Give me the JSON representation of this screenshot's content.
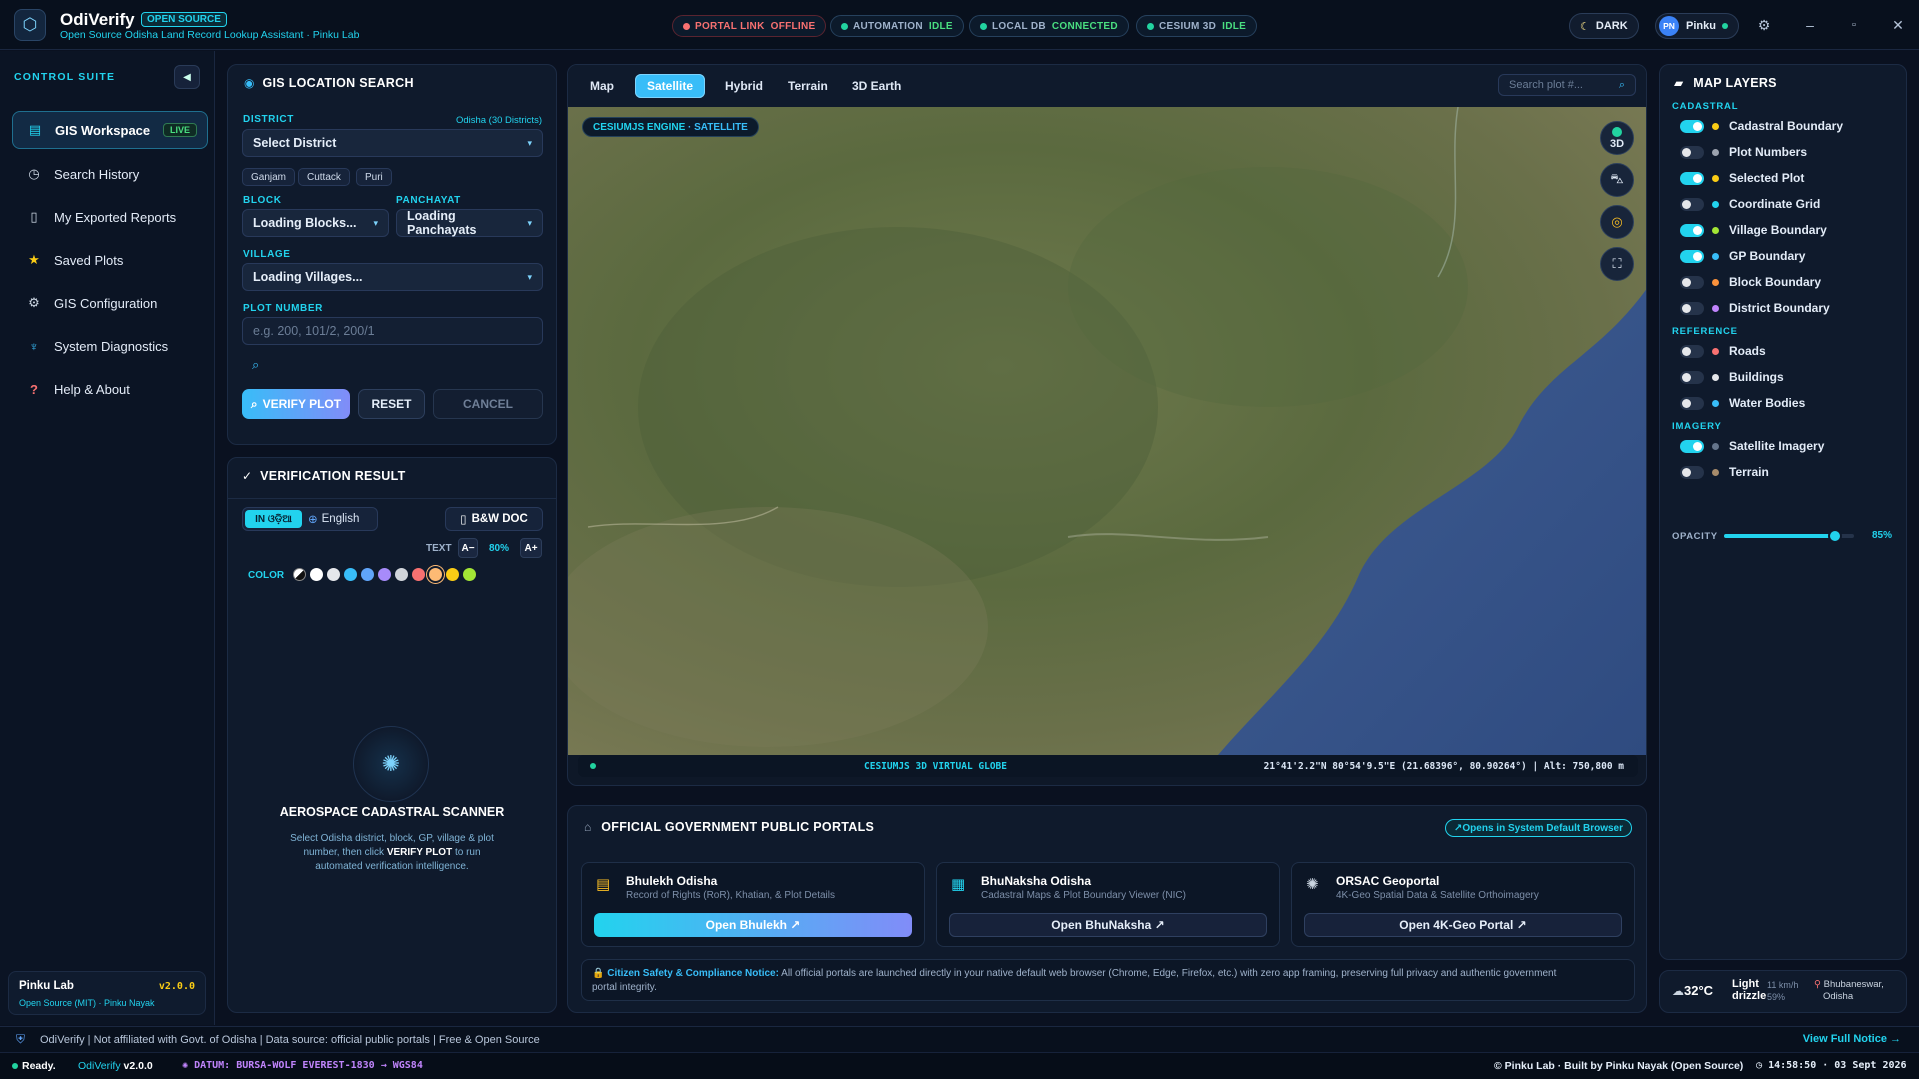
{
  "topbar": {
    "app_name": "OdiVerify",
    "badge": "OPEN SOURCE",
    "subtitle": "Open Source Odisha Land Record Lookup Assistant · Pinku Lab",
    "statuses": [
      {
        "label": "PORTAL LINK",
        "value": "OFFLINE",
        "color": "#f87171"
      },
      {
        "label": "AUTOMATION",
        "value": "IDLE",
        "color": "#22d3a0"
      },
      {
        "label": "LOCAL DB",
        "value": "CONNECTED",
        "color": "#22d3a0"
      },
      {
        "label": "CESIUM 3D",
        "value": "IDLE",
        "color": "#22d3a0"
      }
    ],
    "theme_label": "DARK",
    "user_initials": "PN",
    "user_name": "Pinku"
  },
  "sidebar": {
    "heading": "CONTROL SUITE",
    "items": [
      {
        "label": "GIS Workspace",
        "icon": "map-icon",
        "badge": "LIVE"
      },
      {
        "label": "Search History",
        "icon": "clock-icon"
      },
      {
        "label": "My Exported Reports",
        "icon": "document-icon"
      },
      {
        "label": "Saved Plots",
        "icon": "star-icon"
      },
      {
        "label": "GIS Configuration",
        "icon": "gear-icon"
      },
      {
        "label": "System Diagnostics",
        "icon": "stethoscope-icon"
      },
      {
        "label": "Help & About",
        "icon": "question-icon"
      }
    ],
    "footer_name": "Pinku Lab",
    "footer_version": "v2.0.0",
    "footer_sub": "Open Source (MIT) · Pinku Nayak"
  },
  "search": {
    "title": "GIS LOCATION SEARCH",
    "district_label": "DISTRICT",
    "district_note": "Odisha (30 Districts)",
    "district_value": "Select District",
    "chips": [
      "Ganjam",
      "Cuttack",
      "Puri"
    ],
    "block_label": "BLOCK",
    "block_value": "Loading Blocks...",
    "panchayat_label": "PANCHAYAT",
    "panchayat_value": "Loading Panchayats",
    "village_label": "VILLAGE",
    "village_value": "Loading Villages...",
    "plot_label": "PLOT NUMBER",
    "plot_placeholder": "e.g. 200, 101/2, 200/1",
    "verify_label": "VERIFY PLOT",
    "reset_label": "RESET",
    "cancel_label": "CANCEL"
  },
  "verification": {
    "title": "VERIFICATION RESULT",
    "lang_odia": "IN ଓଡ଼ିଆ",
    "lang_english": "English",
    "bw_doc": "B&W DOC",
    "text_label": "TEXT",
    "text_minus": "A−",
    "text_size": "80%",
    "text_plus": "A+",
    "color_label": "COLOR",
    "colors": [
      "#ffffff",
      "#e5e7eb",
      "#38bdf8",
      "#60a5fa",
      "#a78bfa",
      "#d1d5db",
      "#f87171",
      "#fdba74",
      "#facc15",
      "#a3e635"
    ],
    "scanner_title": "AEROSPACE CADASTRAL SCANNER",
    "scanner_desc_1": "Select Odisha district, block, GP, village & plot",
    "scanner_desc_2a": "number, then click ",
    "scanner_desc_2b": "VERIFY PLOT",
    "scanner_desc_2c": " to run",
    "scanner_desc_3": "automated verification intelligence."
  },
  "map": {
    "tabs": [
      "Map",
      "Satellite",
      "Hybrid",
      "Terrain",
      "3D Earth"
    ],
    "active_tab": "Satellite",
    "search_placeholder": "Search plot #...",
    "engine_label": "CESIUMJS ENGINE",
    "engine_mode": "· SATELLITE",
    "ctrl_3d": "3D",
    "footer_label": "CESIUMJS 3D VIRTUAL GLOBE",
    "coords": "21°41'2.2\"N 80°54'9.5\"E (21.68396°, 80.90264°) | Alt: 750,800 m"
  },
  "layers": {
    "title": "MAP LAYERS",
    "groups": [
      {
        "name": "CADASTRAL",
        "items": [
          {
            "label": "Cadastral Boundary",
            "on": true,
            "color": "#facc15"
          },
          {
            "label": "Plot Numbers",
            "on": false,
            "color": "#9ca3af"
          },
          {
            "label": "Selected Plot",
            "on": true,
            "color": "#facc15"
          },
          {
            "label": "Coordinate Grid",
            "on": false,
            "color": "#22d3ee"
          },
          {
            "label": "Village Boundary",
            "on": true,
            "color": "#a3e635"
          },
          {
            "label": "GP Boundary",
            "on": true,
            "color": "#38bdf8"
          },
          {
            "label": "Block Boundary",
            "on": false,
            "color": "#fb923c"
          },
          {
            "label": "District Boundary",
            "on": false,
            "color": "#c084fc"
          }
        ]
      },
      {
        "name": "REFERENCE",
        "items": [
          {
            "label": "Roads",
            "on": false,
            "color": "#f87171"
          },
          {
            "label": "Buildings",
            "on": false,
            "color": "#e5e7eb"
          },
          {
            "label": "Water Bodies",
            "on": false,
            "color": "#38bdf8"
          }
        ]
      },
      {
        "name": "IMAGERY",
        "items": [
          {
            "label": "Satellite Imagery",
            "on": true,
            "color": "#64748b"
          },
          {
            "label": "Terrain",
            "on": false,
            "color": "#a78b6b"
          }
        ]
      }
    ],
    "opacity_label": "OPACITY",
    "opacity_value": "85%",
    "opacity": 0.85,
    "weather_temp": "32°C",
    "weather_desc_1": "Light",
    "weather_desc_2": "drizzle",
    "wind": "11 km/h",
    "humidity": "59%",
    "location_1": "Bhubaneswar,",
    "location_2": "Odisha"
  },
  "portals": {
    "title": "OFFICIAL GOVERNMENT PUBLIC PORTALS",
    "opens_note": "↗Opens in System Default Browser",
    "cards": [
      {
        "name": "Bhulekh Odisha",
        "desc": "Record of Rights (RoR), Khatian, & Plot Details",
        "button": "Open Bhulekh ↗"
      },
      {
        "name": "BhuNaksha Odisha",
        "desc": "Cadastral Maps & Plot Boundary Viewer (NIC)",
        "button": "Open BhuNaksha ↗"
      },
      {
        "name": "ORSAC Geoportal",
        "desc": "4K-Geo Spatial Data & Satellite Orthoimagery",
        "button": "Open 4K-Geo Portal ↗"
      }
    ],
    "notice_title": "Citizen Safety & Compliance Notice:",
    "notice_text_1": " All official portals are launched directly in your native default web browser (Chrome, Edge, Firefox, etc.) with zero app framing, preserving full privacy and authentic government",
    "notice_text_2": "portal integrity."
  },
  "footer": {
    "disclaimer": "OdiVerify | Not affiliated with Govt. of Odisha | Data source: official public portals | Free & Open Source",
    "view_notice": "View Full Notice →",
    "ready": "Ready.",
    "version_prefix": "OdiVerify ",
    "version": "v2.0.0",
    "datum": "DATUM: BURSA-WOLF EVEREST-1830 → WGS84",
    "credit": "© Pinku Lab · Built by Pinku Nayak (Open Source)",
    "clock": "14:58:50 · 03 Sept 2026"
  }
}
